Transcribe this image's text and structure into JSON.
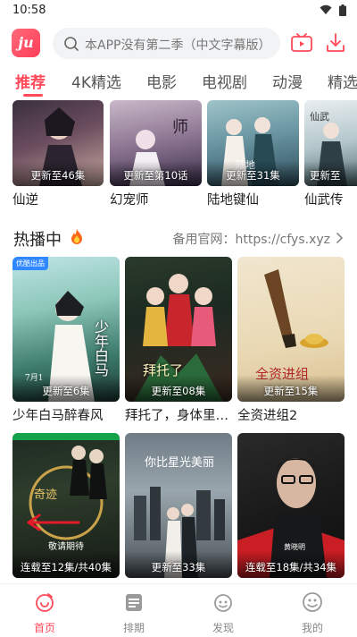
{
  "status_bar": {
    "time": "10:58"
  },
  "header": {
    "logo_text": "ju",
    "search_placeholder": "本APP没有第二季（中文字幕版）",
    "accent_color": "#ff4a5a"
  },
  "tabs": [
    {
      "label": "推荐",
      "active": true
    },
    {
      "label": "4K精选",
      "active": false
    },
    {
      "label": "电影",
      "active": false
    },
    {
      "label": "电视剧",
      "active": false
    },
    {
      "label": "动漫",
      "active": false
    },
    {
      "label": "精选",
      "active": false
    }
  ],
  "top_row": [
    {
      "title": "仙逆",
      "badge": "更新至46集"
    },
    {
      "title": "幻宠师",
      "badge": "更新至第10话"
    },
    {
      "title": "陆地键仙",
      "badge": "更新至31集"
    },
    {
      "title": "仙武传",
      "badge": "更新至"
    }
  ],
  "hot_section": {
    "title": "热播中",
    "link_text": "备用官网：https://cfys.xyz"
  },
  "hot_cards": [
    {
      "title": "少年白马醉春风",
      "badge": "更新至6集",
      "corner_tag": "优酷出品",
      "poster_text": "少年白马",
      "date_text": "7月1"
    },
    {
      "title": "拜托了，身体里的他",
      "badge": "更新至08集",
      "poster_text": "拜托了"
    },
    {
      "title": "全资进组2",
      "badge": "更新至15集",
      "poster_text": "全资进组"
    },
    {
      "title": "",
      "badge": "连载至12集/共40集",
      "sub_badge": "敬请期待",
      "corner_tag": "",
      "poster_text": "奇迹"
    },
    {
      "title": "",
      "badge": "更新至33集",
      "poster_text": "你比星光美丽"
    },
    {
      "title": "",
      "badge": "连载至18集/共34集",
      "poster_text": "黄晓明"
    }
  ],
  "bottom_nav": [
    {
      "label": "首页",
      "icon": "home-icon",
      "active": true
    },
    {
      "label": "排期",
      "icon": "schedule-icon",
      "active": false
    },
    {
      "label": "发现",
      "icon": "discover-icon",
      "active": false
    },
    {
      "label": "我的",
      "icon": "profile-icon",
      "active": false
    }
  ]
}
